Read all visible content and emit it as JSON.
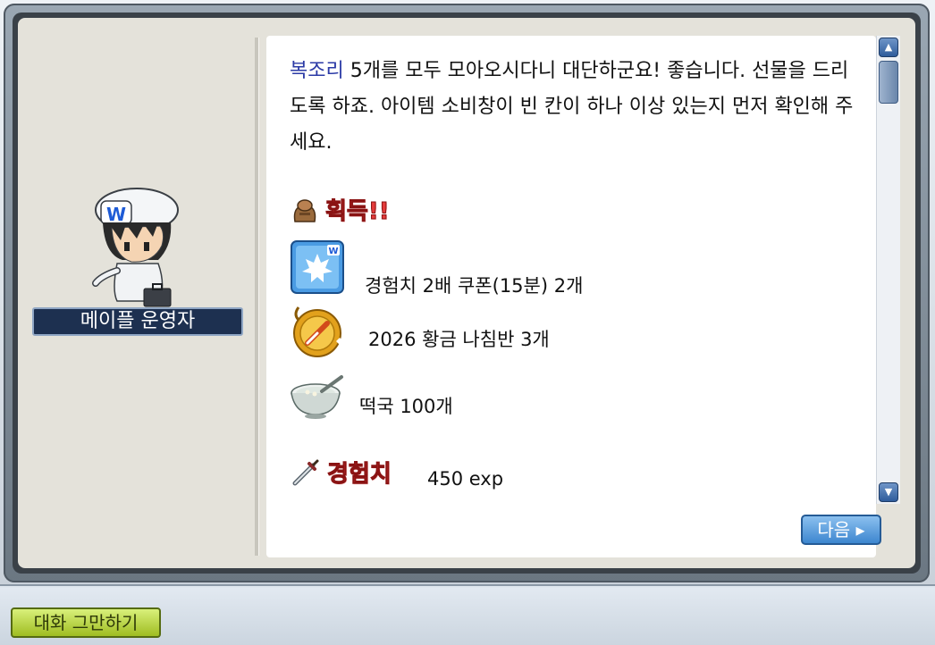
{
  "npc": {
    "name": "메이플 운영자",
    "hat_letter": "W"
  },
  "dialog": {
    "highlight": "복조리",
    "message": " 5개를 모두 모아오시다니 대단하군요! 좋습니다. 선물을 드리도록 하죠. 아이템 소비창이 빈 칸이 하나 이상 있는지 먼저 확인해 주세요.",
    "reward_title": "획득!!",
    "items": [
      {
        "icon": "maple-coupon-icon",
        "label": "경험치 2배 쿠폰(15분) 2개"
      },
      {
        "icon": "golden-compass-icon",
        "label": "2026 황금 나침반 3개"
      },
      {
        "icon": "rice-cake-soup-icon",
        "label": "떡국 100개"
      }
    ],
    "exp_title": "경험치",
    "exp_value": "450 exp"
  },
  "buttons": {
    "next": "다음 ▸",
    "end_chat": "대화 그만하기"
  },
  "colors": {
    "highlight_text": "#2b3aa6",
    "section_title": "#e53b3b",
    "name_plate": "#1d3050"
  }
}
